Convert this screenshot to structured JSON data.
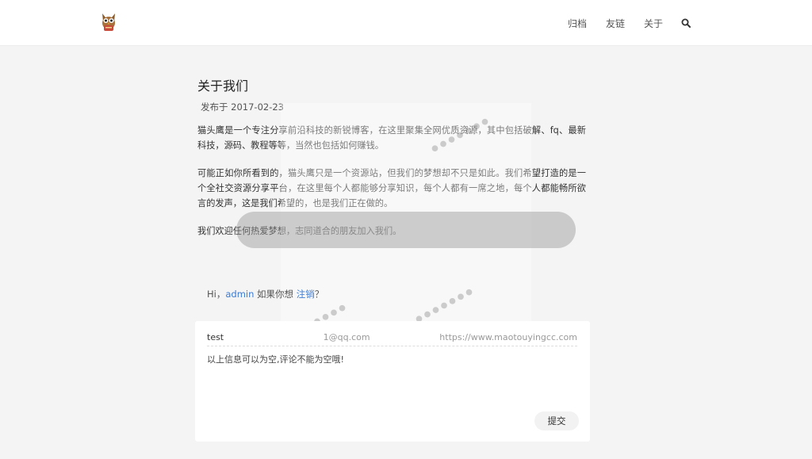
{
  "nav": {
    "items": [
      {
        "label": "归档"
      },
      {
        "label": "友链"
      },
      {
        "label": "关于"
      }
    ],
    "search_icon": "search-icon"
  },
  "logo_icon": "owl-icon",
  "post": {
    "title": "关于我们",
    "meta": "发布于 2017-02-23",
    "paragraphs": [
      "猫头鹰是一个专注分享前沿科技的新锐博客，在这里聚集全网优质资源，其中包括破解、fq、最新科技，源码、教程等等，当然也包括如何赚钱。",
      "可能正如你所看到的，猫头鹰只是一个资源站，但我们的梦想却不只是如此。我们希望打造的是一个全社交资源分享平台，在这里每个人都能够分享知识，每个人都有一席之地，每个人都能畅所欲言的发声，这是我们希望的，也是我们正在做的。",
      "我们欢迎任何热爱梦想，志同道合的朋友加入我们。"
    ]
  },
  "comment": {
    "greeting_prefix": "Hi，",
    "username": "admin",
    "greeting_middle": " 如果你想 ",
    "logout_label": "注销",
    "greeting_suffix": "？",
    "name_value": "test",
    "email_value": "1@qq.com",
    "site_value": "https://www.maotouyingcc.com",
    "text_value": "以上信息可以为空,评论不能为空哦!",
    "submit_label": "提交"
  },
  "colors": {
    "accent": "#3a7bd5",
    "background": "#f4f4f4"
  }
}
